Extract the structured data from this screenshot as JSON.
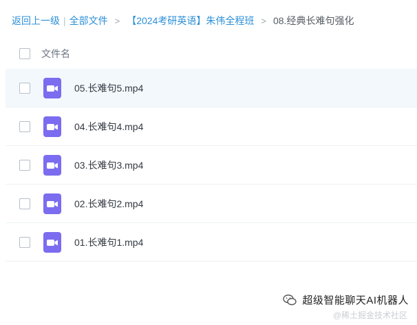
{
  "breadcrumb": {
    "back": "返回上一级",
    "separator": "|",
    "all_files": "全部文件",
    "folder": "【2024考研英语】朱伟全程班",
    "current": "08.经典长难句强化",
    "arrow": ">"
  },
  "list": {
    "header": "文件名",
    "icon_color": "#7b6cf0",
    "files": [
      {
        "name": "05.长难句5.mp4",
        "icon": "video-file-icon"
      },
      {
        "name": "04.长难句4.mp4",
        "icon": "video-file-icon"
      },
      {
        "name": "03.长难句3.mp4",
        "icon": "video-file-icon"
      },
      {
        "name": "02.长难句2.mp4",
        "icon": "video-file-icon"
      },
      {
        "name": "01.长难句1.mp4",
        "icon": "video-file-icon"
      }
    ]
  },
  "watermark": {
    "text": "超级智能聊天AI机器人",
    "sub": "@稀土掘金技术社区"
  }
}
